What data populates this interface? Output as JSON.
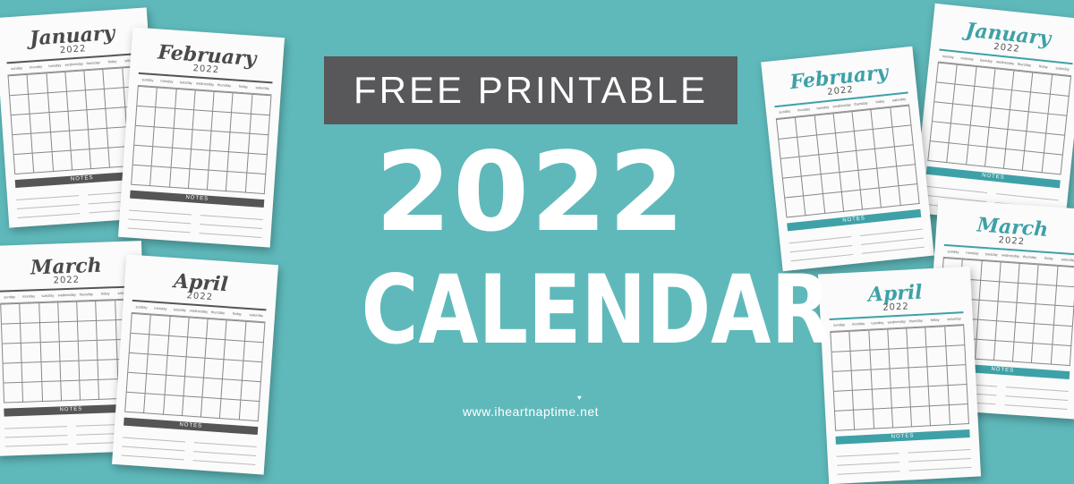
{
  "banner": {
    "text": "FREE PRINTABLE"
  },
  "headline": {
    "year": "2022",
    "word": "CALENDAR"
  },
  "site": {
    "text": "www.iheartnaptime.net"
  },
  "colors": {
    "background": "#5fb9bb",
    "banner": "#58585a",
    "teal": "#3ea1a7",
    "dark": "#4a4a4a"
  },
  "weekdays": [
    "sunday",
    "monday",
    "tuesday",
    "wednesday",
    "thursday",
    "friday",
    "saturday"
  ],
  "notes_label": "NOTES",
  "calendars": {
    "jan_dark": {
      "month": "January",
      "year": "2022"
    },
    "feb_dark": {
      "month": "February",
      "year": "2022"
    },
    "mar_dark": {
      "month": "March",
      "year": "2022"
    },
    "apr_dark": {
      "month": "April",
      "year": "2022"
    },
    "feb_teal": {
      "month": "February",
      "year": "2022"
    },
    "jan_teal": {
      "month": "January",
      "year": "2022"
    },
    "mar_teal": {
      "month": "March",
      "year": "2022"
    },
    "apr_teal": {
      "month": "April",
      "year": "2022"
    }
  }
}
